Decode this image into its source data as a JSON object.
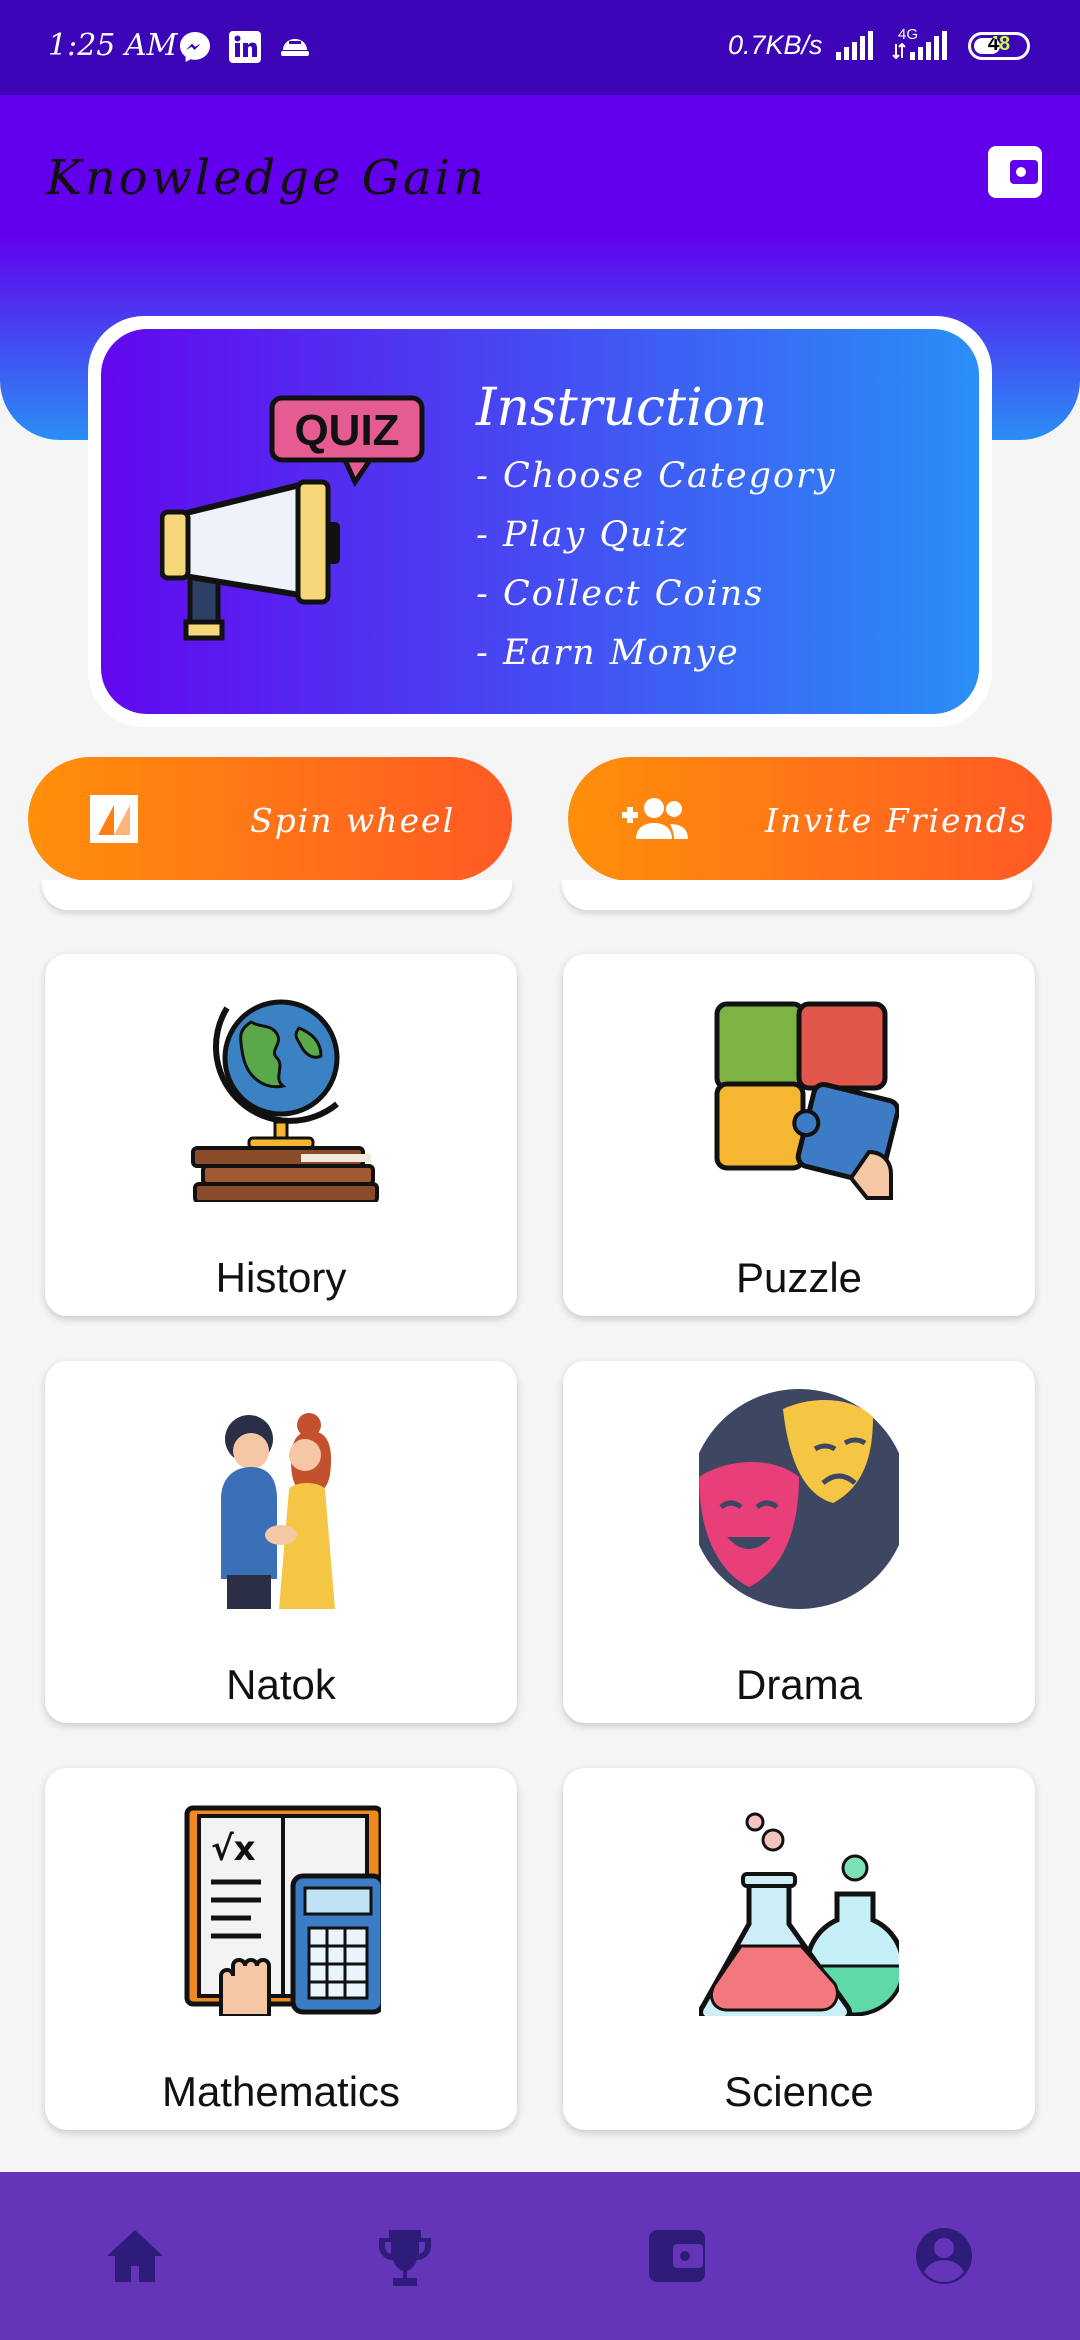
{
  "status_bar": {
    "time": "1:25 AM",
    "net_speed": "0.7KB/s",
    "network_type": "4G",
    "battery": "48",
    "icons": [
      "messenger-icon",
      "linkedin-icon",
      "notification-icon",
      "signal-icon",
      "battery-icon"
    ]
  },
  "app": {
    "title": "Knowledge Gain",
    "wallet_icon": "wallet-icon"
  },
  "instruction": {
    "title": "Instruction",
    "badge": "QUIZ",
    "lines": [
      "- Choose Category",
      "- Play Quiz",
      "- Collect Coins",
      "- Earn Monye"
    ]
  },
  "actions": {
    "spin": {
      "label": "Spin wheel",
      "icon": "spin-icon"
    },
    "invite": {
      "label": "Invite Friends",
      "icon": "add-people-icon"
    }
  },
  "categories": [
    {
      "label": "History",
      "icon": "globe-books-icon"
    },
    {
      "label": "Puzzle",
      "icon": "puzzle-icon"
    },
    {
      "label": "Natok",
      "icon": "couple-icon"
    },
    {
      "label": "Drama",
      "icon": "theater-masks-icon"
    },
    {
      "label": "Mathematics",
      "icon": "math-book-calculator-icon"
    },
    {
      "label": "Science",
      "icon": "lab-flasks-icon"
    }
  ],
  "bottom_nav": [
    {
      "name": "home",
      "icon": "home-icon"
    },
    {
      "name": "leaderboard",
      "icon": "trophy-icon"
    },
    {
      "name": "wallet",
      "icon": "wallet-icon"
    },
    {
      "name": "profile",
      "icon": "account-icon"
    }
  ],
  "colors": {
    "status_bar": "#3d05b8",
    "primary": "#6200ee",
    "gradient_end": "#2a8ef5",
    "accent_orange": "#ff8f0a",
    "accent_red_orange": "#ff5a24",
    "bottom_nav": "#6535b9",
    "nav_icon": "#2e1c7a"
  }
}
